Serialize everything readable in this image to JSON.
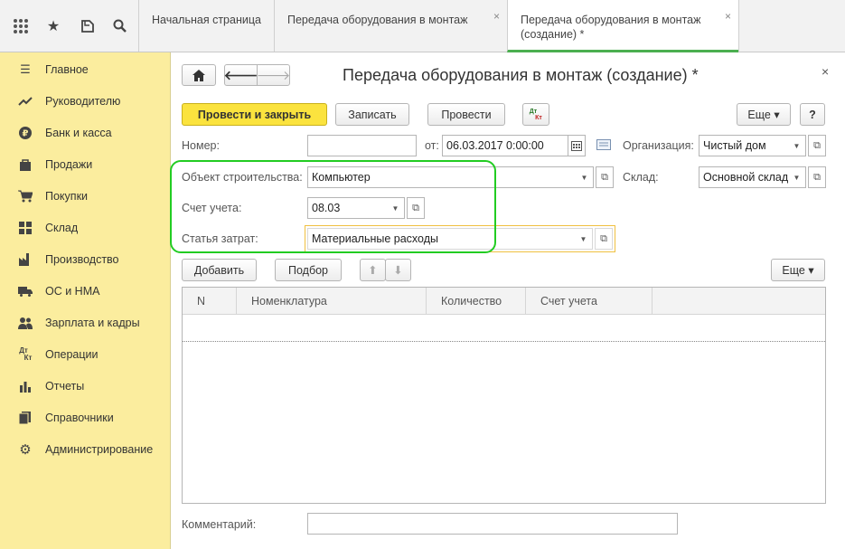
{
  "topbar": {
    "icons": [
      "grid-icon",
      "star-icon",
      "history-icon",
      "search-icon"
    ],
    "tabs": [
      {
        "label": "Начальная страница"
      },
      {
        "label": "Передача оборудования в монтаж",
        "close": "×"
      },
      {
        "label": "Передача оборудования в монтаж (создание) *",
        "close": "×"
      }
    ]
  },
  "sidebar": {
    "items": [
      {
        "label": "Главное",
        "icon": "menu-icon"
      },
      {
        "label": "Руководителю",
        "icon": "trend-icon"
      },
      {
        "label": "Банк и касса",
        "icon": "ruble-icon"
      },
      {
        "label": "Продажи",
        "icon": "bag-icon"
      },
      {
        "label": "Покупки",
        "icon": "cart-icon"
      },
      {
        "label": "Склад",
        "icon": "warehouse-icon"
      },
      {
        "label": "Производство",
        "icon": "factory-icon"
      },
      {
        "label": "ОС и НМА",
        "icon": "truck-icon"
      },
      {
        "label": "Зарплата и кадры",
        "icon": "people-icon"
      },
      {
        "label": "Операции",
        "icon": "dt-kt-icon"
      },
      {
        "label": "Отчеты",
        "icon": "bar-chart-icon"
      },
      {
        "label": "Справочники",
        "icon": "books-icon"
      },
      {
        "label": "Администрирование",
        "icon": "gear-icon"
      }
    ]
  },
  "form": {
    "title": "Передача оборудования в монтаж (создание) *",
    "close": "×",
    "toolbar": {
      "post_close": "Провести и закрыть",
      "save": "Записать",
      "post": "Провести",
      "dtkt_top": "Дт",
      "dtkt_bottom": "Кт",
      "more": "Еще ▾",
      "help": "?"
    },
    "number_label": "Номер:",
    "number_value": "",
    "date_label": "от:",
    "date_value": "06.03.2017  0:00:00",
    "org_label": "Организация:",
    "org_value": "Чистый дом",
    "object_label": "Объект строительства:",
    "object_value": "Компьютер",
    "warehouse_label": "Склад:",
    "warehouse_value": "Основной склад",
    "account_label": "Счет учета:",
    "account_value": "08.03",
    "cost_label": "Статья затрат:",
    "cost_value": "Материальные расходы",
    "table_toolbar": {
      "add": "Добавить",
      "select": "Подбор",
      "more": "Еще ▾"
    },
    "table_columns": [
      "N",
      "Номенклатура",
      "Количество",
      "Счет учета"
    ],
    "comment_label": "Комментарий:",
    "comment_value": ""
  },
  "colors": {
    "sidebar_bg": "#fbed9e",
    "primary_button": "#fbe33e",
    "highlight_outline": "#22cc22",
    "active_field_border": "#f0c040"
  }
}
